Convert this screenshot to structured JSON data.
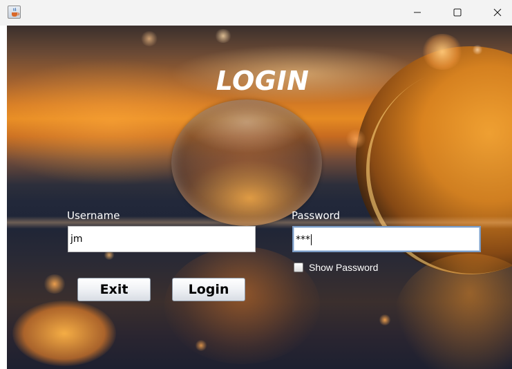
{
  "window": {
    "title_bar": {
      "app_icon": "java-coffee-cup-icon",
      "controls": {
        "minimize_icon": "minimize-icon",
        "maximize_icon": "maximize-icon",
        "close_icon": "close-icon"
      }
    }
  },
  "login": {
    "title": "LOGIN",
    "username": {
      "label": "Username",
      "value": "jm"
    },
    "password": {
      "label": "Password",
      "value": "***"
    },
    "show_password": {
      "label": "Show Password",
      "checked": false
    },
    "buttons": {
      "exit_label": "Exit",
      "login_label": "Login"
    }
  },
  "colors": {
    "title_text": "#ffffff",
    "label_text": "#ffffff",
    "focus_border": "#7a9bc4",
    "sunset_orange": "#e58a22"
  }
}
